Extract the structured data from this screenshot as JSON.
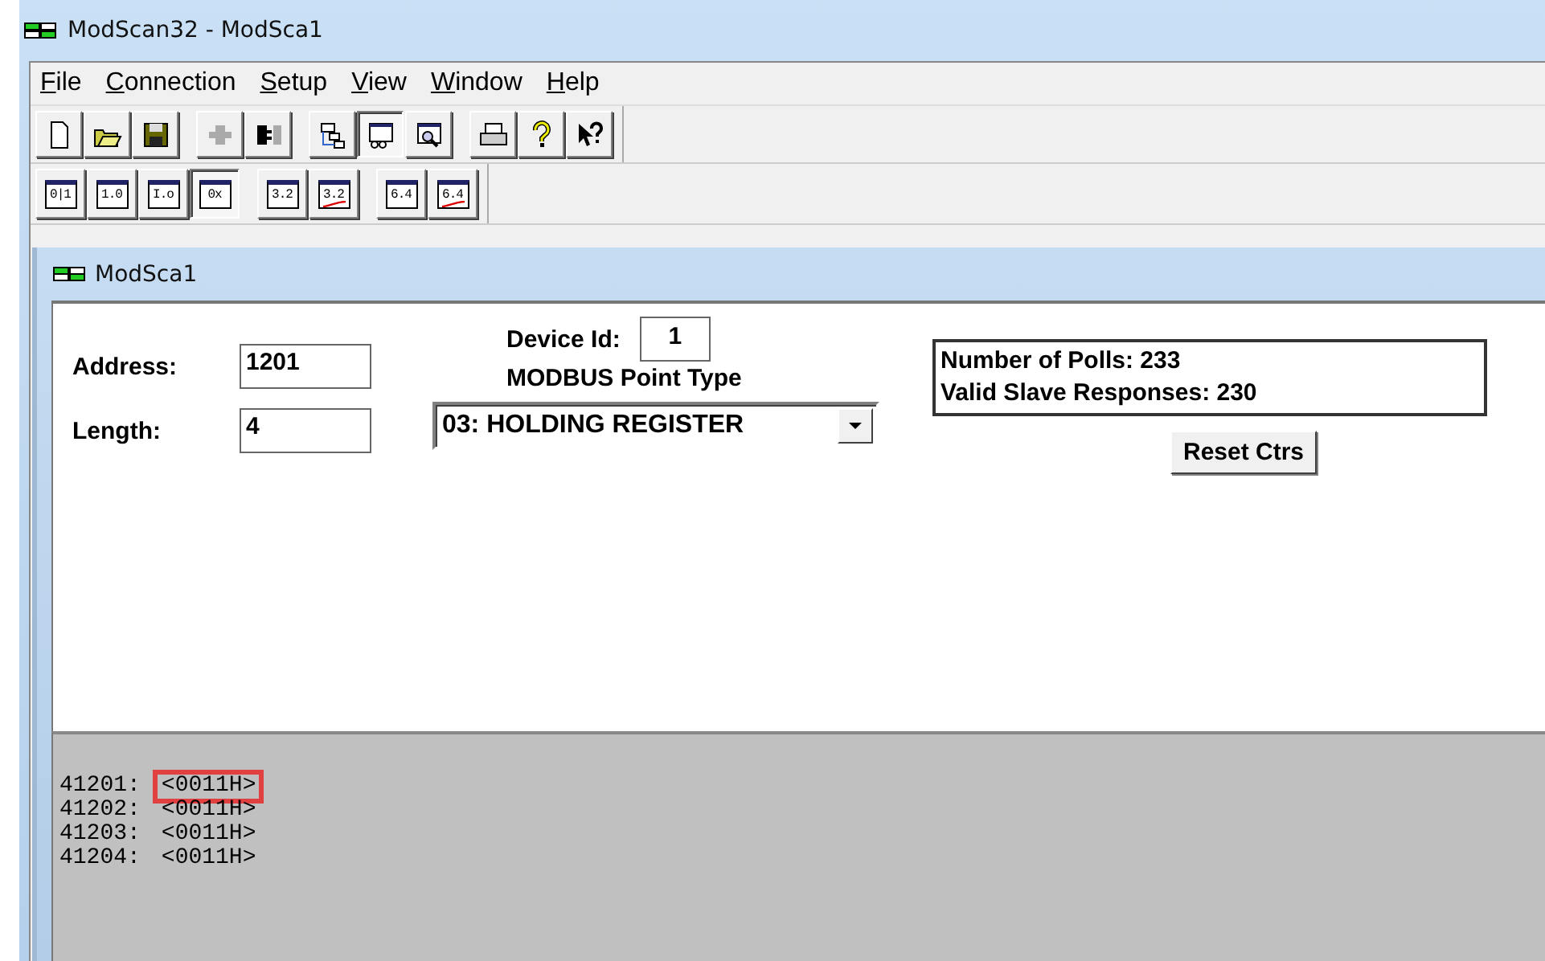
{
  "window": {
    "title": "ModScan32 - ModSca1"
  },
  "menu": [
    "File",
    "Connection",
    "Setup",
    "View",
    "Window",
    "Help"
  ],
  "toolbar": [
    {
      "kind": "new",
      "pressed": false
    },
    {
      "kind": "open",
      "pressed": false
    },
    {
      "kind": "save",
      "pressed": false
    },
    {
      "kind": "connect",
      "pressed": false
    },
    {
      "kind": "disconnect",
      "pressed": false
    },
    {
      "kind": "tree",
      "pressed": false
    },
    {
      "kind": "display",
      "pressed": true
    },
    {
      "kind": "zoom",
      "pressed": false
    },
    {
      "kind": "print",
      "pressed": false
    },
    {
      "kind": "help",
      "pressed": false
    },
    {
      "kind": "context-help",
      "pressed": false
    }
  ],
  "format_toolbar": [
    {
      "label": "0|1",
      "pressed": false,
      "crossed": false
    },
    {
      "label": "1.0",
      "pressed": false,
      "crossed": false
    },
    {
      "label": "I.o",
      "pressed": false,
      "crossed": false
    },
    {
      "label": "0x",
      "pressed": true,
      "crossed": false
    },
    {
      "label": "3.2",
      "pressed": false,
      "crossed": false
    },
    {
      "label": "3.2",
      "pressed": false,
      "crossed": true
    },
    {
      "label": "6.4",
      "pressed": false,
      "crossed": false
    },
    {
      "label": "6.4",
      "pressed": false,
      "crossed": true
    }
  ],
  "child_window": {
    "title": "ModSca1",
    "address": {
      "label": "Address:",
      "value": "1201"
    },
    "length": {
      "label": "Length:",
      "value": "4"
    },
    "device_id": {
      "label": "Device Id:",
      "value": "1"
    },
    "point_type": {
      "label": "MODBUS Point Type",
      "value": "03: HOLDING REGISTER"
    },
    "counters": [
      "Number of Polls: 233",
      "Valid Slave Responses: 230"
    ],
    "reset_button": "Reset Ctrs",
    "registers": [
      {
        "address": "41201:",
        "value": "<0011H>",
        "highlighted": true
      },
      {
        "address": "41202:",
        "value": "<0011H>",
        "highlighted": false
      },
      {
        "address": "41203:",
        "value": "<0011H>",
        "highlighted": false
      },
      {
        "address": "41204:",
        "value": "<0011H>",
        "highlighted": false
      }
    ]
  }
}
